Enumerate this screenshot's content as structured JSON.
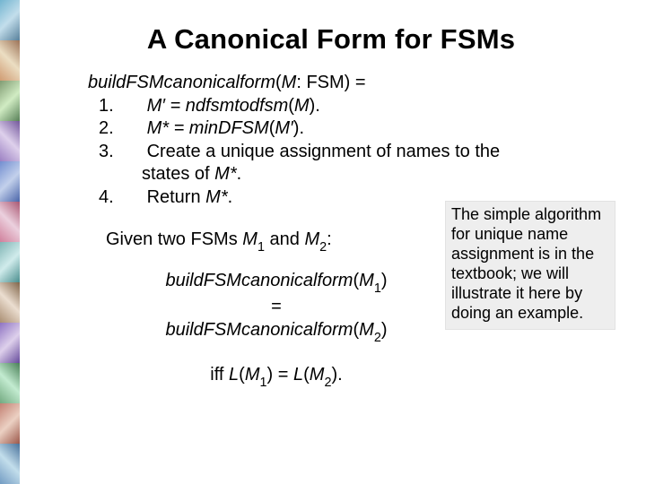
{
  "title": "A Canonical Form for FSMs",
  "algo": {
    "sig_a": "buildFSMcanonicalform",
    "sig_b": "(",
    "sig_c": "M",
    "sig_d": ": FSM) =",
    "s1n": "1.",
    "s1a": "M′ = ndfsmtodfsm",
    "s1b": "(",
    "s1c": "M",
    "s1d": ").",
    "s2n": "2.",
    "s2a": "M* = minDFSM",
    "s2b": "(",
    "s2c": "M′",
    "s2d": ").",
    "s3n": "3.",
    "s3a": "Create a unique assignment of names to the",
    "s3cont_a": "states of ",
    "s3cont_b": "M*",
    "s3cont_c": ".",
    "s4n": "4.",
    "s4a": "Return ",
    "s4b": "M*",
    "s4c": "."
  },
  "given": {
    "a": "Given two FSMs ",
    "m1": "M",
    "sub1": "1",
    "mid": " and ",
    "m2": "M",
    "sub2": "2",
    "end": ":"
  },
  "eq": {
    "fn1": "buildFSMcanonicalform",
    "arg1a": "(",
    "arg1b": "M",
    "arg1s": "1",
    "arg1c": ")",
    "eqsign": "=",
    "fn2": "buildFSMcanonicalform",
    "arg2a": "(",
    "arg2b": "M",
    "arg2s": "2",
    "arg2c": ")"
  },
  "iff": {
    "a": "iff ",
    "l1a": "L",
    "l1b": "(",
    "l1c": "M",
    "l1s": "1",
    "l1d": ")",
    "mid": " = ",
    "l2a": "L",
    "l2b": "(",
    "l2c": "M",
    "l2s": "2",
    "l2d": ").",
    "end": ""
  },
  "note": "The simple algorithm for unique name assignment is in the textbook; we will illustrate it here by doing an example.",
  "deco_colors": [
    "#5aa8c8",
    "#8ac5d8",
    "#c88a5a",
    "#d8b88a",
    "#6a8a5a",
    "#a8c888",
    "#8a6ab8",
    "#c8a8d8",
    "#5a7ac8",
    "#a8b8e8",
    "#c86a8a",
    "#e8b8c8",
    "#6aa8a8",
    "#b8d8d8",
    "#9a7a5a",
    "#d8c8a8",
    "#7a5ab8"
  ]
}
